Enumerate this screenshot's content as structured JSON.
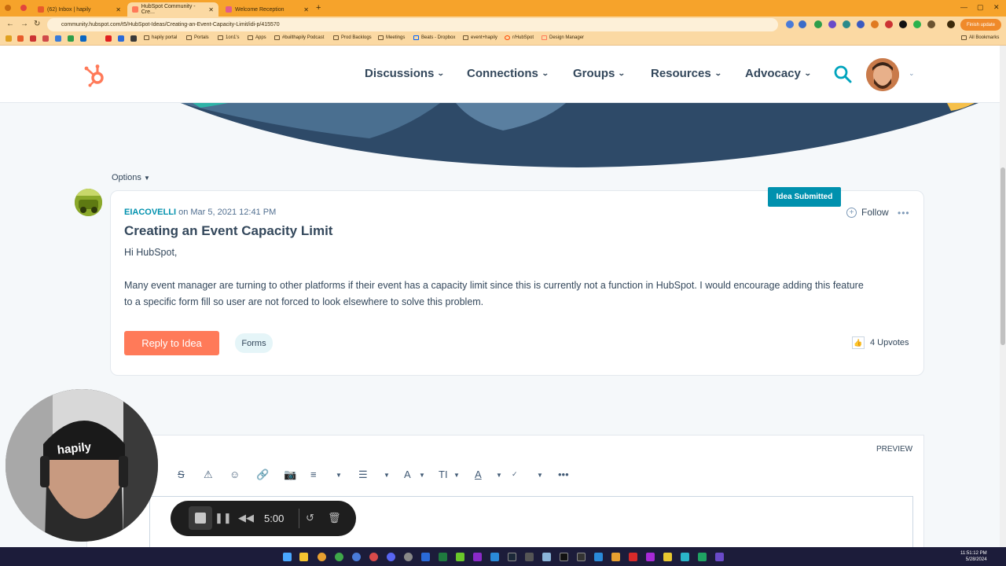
{
  "browser": {
    "tabs": [
      {
        "label": "(62) Inbox | hapily",
        "active": false
      },
      {
        "label": "HubSpot Community - Cre...",
        "active": true
      },
      {
        "label": "Welcome Reception",
        "active": false
      }
    ],
    "new_tab": "+",
    "url": "community.hubspot.com/t5/HubSpot-Ideas/Creating-an-Event-Capacity-Limit/idi-p/415570",
    "update_label": "Finish update",
    "bookmarks": [
      {
        "label": "hapily portal"
      },
      {
        "label": "Portals"
      },
      {
        "label": "1on1's"
      },
      {
        "label": "Apps"
      },
      {
        "label": "#builthapily Podcast"
      },
      {
        "label": "Prod Backlogs"
      },
      {
        "label": "Meetings"
      },
      {
        "label": "Beats - Dropbox"
      },
      {
        "label": "event+hapily"
      },
      {
        "label": "r/HubSpot"
      },
      {
        "label": "Design Manager"
      }
    ],
    "all_bookmarks": "All Bookmarks"
  },
  "header": {
    "nav": [
      {
        "label": "Discussions"
      },
      {
        "label": "Connections"
      },
      {
        "label": "Groups"
      },
      {
        "label": "Resources"
      },
      {
        "label": "Advocacy"
      }
    ]
  },
  "options_label": "Options",
  "post": {
    "status_badge": "Idea Submitted",
    "author": "EIACOVELLI",
    "on": "on",
    "date": "Mar 5, 2021 12:41 PM",
    "follow_label": "Follow",
    "title": "Creating an Event Capacity Limit",
    "greeting": "Hi HubSpot,",
    "body_line1": "Many event manager are turning to other platforms if their event has a capacity limit since this is currently not a function in HubSpot. I would encourage adding this feature",
    "body_line2": "to a specific form fill so user are not forced to look elsewhere to solve this problem.",
    "reply_label": "Reply to Idea",
    "tag": "Forms",
    "upvotes": "4 Upvotes"
  },
  "editor": {
    "preview_label": "PREVIEW"
  },
  "recorder": {
    "time": "5:00"
  },
  "taskbar": {
    "time": "11:51:12 PM",
    "date": "5/28/2024"
  },
  "colors": {
    "accent": "#0091ae",
    "reply": "#ff7a59",
    "text": "#33475b",
    "browser_frame": "#f6a32b"
  }
}
